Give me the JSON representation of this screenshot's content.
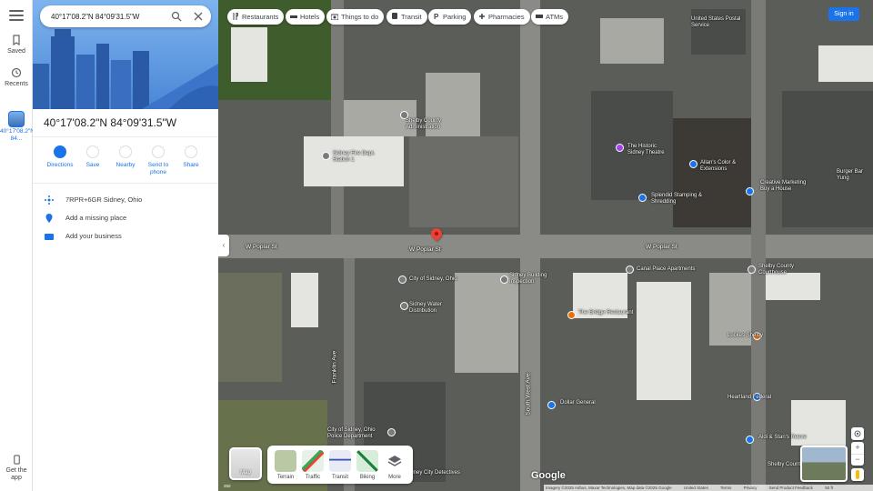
{
  "search": {
    "value": "40°17'08.2\"N 84°09'31.5\"W"
  },
  "rail": {
    "saved": "Saved",
    "recents": "Recents",
    "place_thumb_label": "40°17'08.2\"N 84...",
    "get_app": "Get the app"
  },
  "place": {
    "title": "40°17'08.2\"N 84°09'31.5\"W",
    "actions": [
      {
        "label": "Directions",
        "icon": "directions-icon"
      },
      {
        "label": "Save",
        "icon": "bookmark-icon"
      },
      {
        "label": "Nearby",
        "icon": "nearby-icon"
      },
      {
        "label": "Send to phone",
        "icon": "phone-icon"
      },
      {
        "label": "Share",
        "icon": "share-icon"
      }
    ],
    "info": [
      {
        "text": "7RPR+6GR Sidney, Ohio",
        "icon": "plus-code-icon"
      },
      {
        "text": "Add a missing place",
        "icon": "add-place-icon"
      },
      {
        "text": "Add your business",
        "icon": "business-icon"
      }
    ]
  },
  "chips": [
    "Restaurants",
    "Hotels",
    "Things to do",
    "Transit",
    "Parking",
    "Pharmacies",
    "ATMs"
  ],
  "sign_in": "Sign in",
  "map_labels": {
    "roads": [
      "W Poplar St",
      "W Poplar St",
      "W Poplar St",
      "Franklin Ave",
      "South West Ave"
    ],
    "pois": [
      "Shelby County Administration",
      "Sidney Fire Dept. Station 1",
      "The Historic Sidney Theatre",
      "Allan's Color & Extensions",
      "Creative Marketing Buy a House",
      "Splendid Stamping & Shredding",
      "Canal Place Apartments",
      "Shelby County Courthouse",
      "City of Sidney, Ohio",
      "Sidney Building Inspection",
      "Sidney Water Distribution",
      "The Bridge Restaurant",
      "Lockes Shelby",
      "Dollar General",
      "Heartland Federal",
      "Aldi & Stan's Reeve",
      "City of Sidney, Ohio Police Department",
      "Sidney City Detectives",
      "Shelby County Library",
      "United States Postal Service",
      "Burger Bar Yung"
    ]
  },
  "layers": {
    "map_label": "Map",
    "items": [
      "Terrain",
      "Traffic",
      "Transit",
      "Biking",
      "More"
    ]
  },
  "footer": {
    "brand": "Google",
    "imagery": "Imagery ©2025 Airbus, Maxar Technologies, Map data ©2025 Google",
    "country": "United States",
    "terms": "Terms",
    "privacy": "Privacy",
    "feedback": "Send Product Feedback",
    "scale": "50 ft",
    "scale_left": "250"
  },
  "colors": {
    "accent": "#1a73e8",
    "pin": "#ea4335"
  }
}
